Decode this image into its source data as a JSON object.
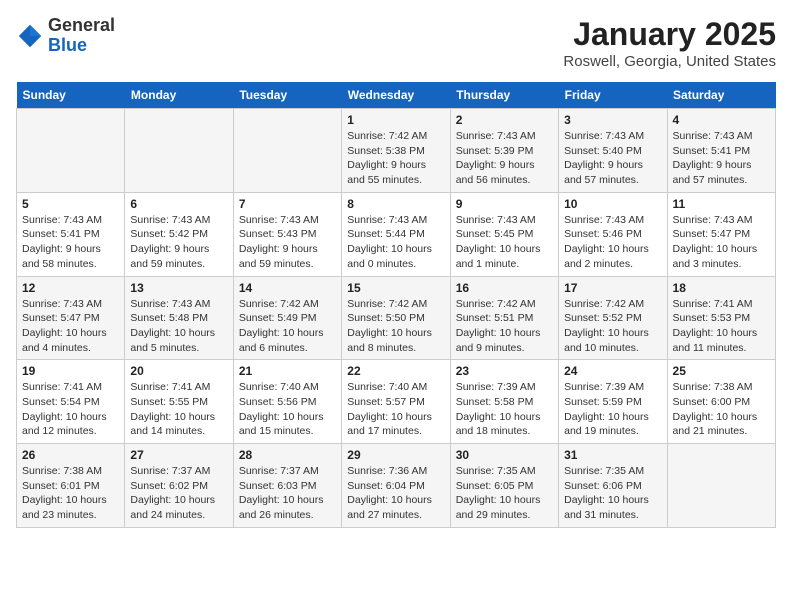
{
  "header": {
    "logo_general": "General",
    "logo_blue": "Blue",
    "month_title": "January 2025",
    "location": "Roswell, Georgia, United States"
  },
  "weekdays": [
    "Sunday",
    "Monday",
    "Tuesday",
    "Wednesday",
    "Thursday",
    "Friday",
    "Saturday"
  ],
  "weeks": [
    [
      {
        "day": null,
        "info": null
      },
      {
        "day": null,
        "info": null
      },
      {
        "day": null,
        "info": null
      },
      {
        "day": "1",
        "info": "Sunrise: 7:42 AM\nSunset: 5:38 PM\nDaylight: 9 hours and 55 minutes."
      },
      {
        "day": "2",
        "info": "Sunrise: 7:43 AM\nSunset: 5:39 PM\nDaylight: 9 hours and 56 minutes."
      },
      {
        "day": "3",
        "info": "Sunrise: 7:43 AM\nSunset: 5:40 PM\nDaylight: 9 hours and 57 minutes."
      },
      {
        "day": "4",
        "info": "Sunrise: 7:43 AM\nSunset: 5:41 PM\nDaylight: 9 hours and 57 minutes."
      }
    ],
    [
      {
        "day": "5",
        "info": "Sunrise: 7:43 AM\nSunset: 5:41 PM\nDaylight: 9 hours and 58 minutes."
      },
      {
        "day": "6",
        "info": "Sunrise: 7:43 AM\nSunset: 5:42 PM\nDaylight: 9 hours and 59 minutes."
      },
      {
        "day": "7",
        "info": "Sunrise: 7:43 AM\nSunset: 5:43 PM\nDaylight: 9 hours and 59 minutes."
      },
      {
        "day": "8",
        "info": "Sunrise: 7:43 AM\nSunset: 5:44 PM\nDaylight: 10 hours and 0 minutes."
      },
      {
        "day": "9",
        "info": "Sunrise: 7:43 AM\nSunset: 5:45 PM\nDaylight: 10 hours and 1 minute."
      },
      {
        "day": "10",
        "info": "Sunrise: 7:43 AM\nSunset: 5:46 PM\nDaylight: 10 hours and 2 minutes."
      },
      {
        "day": "11",
        "info": "Sunrise: 7:43 AM\nSunset: 5:47 PM\nDaylight: 10 hours and 3 minutes."
      }
    ],
    [
      {
        "day": "12",
        "info": "Sunrise: 7:43 AM\nSunset: 5:47 PM\nDaylight: 10 hours and 4 minutes."
      },
      {
        "day": "13",
        "info": "Sunrise: 7:43 AM\nSunset: 5:48 PM\nDaylight: 10 hours and 5 minutes."
      },
      {
        "day": "14",
        "info": "Sunrise: 7:42 AM\nSunset: 5:49 PM\nDaylight: 10 hours and 6 minutes."
      },
      {
        "day": "15",
        "info": "Sunrise: 7:42 AM\nSunset: 5:50 PM\nDaylight: 10 hours and 8 minutes."
      },
      {
        "day": "16",
        "info": "Sunrise: 7:42 AM\nSunset: 5:51 PM\nDaylight: 10 hours and 9 minutes."
      },
      {
        "day": "17",
        "info": "Sunrise: 7:42 AM\nSunset: 5:52 PM\nDaylight: 10 hours and 10 minutes."
      },
      {
        "day": "18",
        "info": "Sunrise: 7:41 AM\nSunset: 5:53 PM\nDaylight: 10 hours and 11 minutes."
      }
    ],
    [
      {
        "day": "19",
        "info": "Sunrise: 7:41 AM\nSunset: 5:54 PM\nDaylight: 10 hours and 12 minutes."
      },
      {
        "day": "20",
        "info": "Sunrise: 7:41 AM\nSunset: 5:55 PM\nDaylight: 10 hours and 14 minutes."
      },
      {
        "day": "21",
        "info": "Sunrise: 7:40 AM\nSunset: 5:56 PM\nDaylight: 10 hours and 15 minutes."
      },
      {
        "day": "22",
        "info": "Sunrise: 7:40 AM\nSunset: 5:57 PM\nDaylight: 10 hours and 17 minutes."
      },
      {
        "day": "23",
        "info": "Sunrise: 7:39 AM\nSunset: 5:58 PM\nDaylight: 10 hours and 18 minutes."
      },
      {
        "day": "24",
        "info": "Sunrise: 7:39 AM\nSunset: 5:59 PM\nDaylight: 10 hours and 19 minutes."
      },
      {
        "day": "25",
        "info": "Sunrise: 7:38 AM\nSunset: 6:00 PM\nDaylight: 10 hours and 21 minutes."
      }
    ],
    [
      {
        "day": "26",
        "info": "Sunrise: 7:38 AM\nSunset: 6:01 PM\nDaylight: 10 hours and 23 minutes."
      },
      {
        "day": "27",
        "info": "Sunrise: 7:37 AM\nSunset: 6:02 PM\nDaylight: 10 hours and 24 minutes."
      },
      {
        "day": "28",
        "info": "Sunrise: 7:37 AM\nSunset: 6:03 PM\nDaylight: 10 hours and 26 minutes."
      },
      {
        "day": "29",
        "info": "Sunrise: 7:36 AM\nSunset: 6:04 PM\nDaylight: 10 hours and 27 minutes."
      },
      {
        "day": "30",
        "info": "Sunrise: 7:35 AM\nSunset: 6:05 PM\nDaylight: 10 hours and 29 minutes."
      },
      {
        "day": "31",
        "info": "Sunrise: 7:35 AM\nSunset: 6:06 PM\nDaylight: 10 hours and 31 minutes."
      },
      {
        "day": null,
        "info": null
      }
    ]
  ]
}
